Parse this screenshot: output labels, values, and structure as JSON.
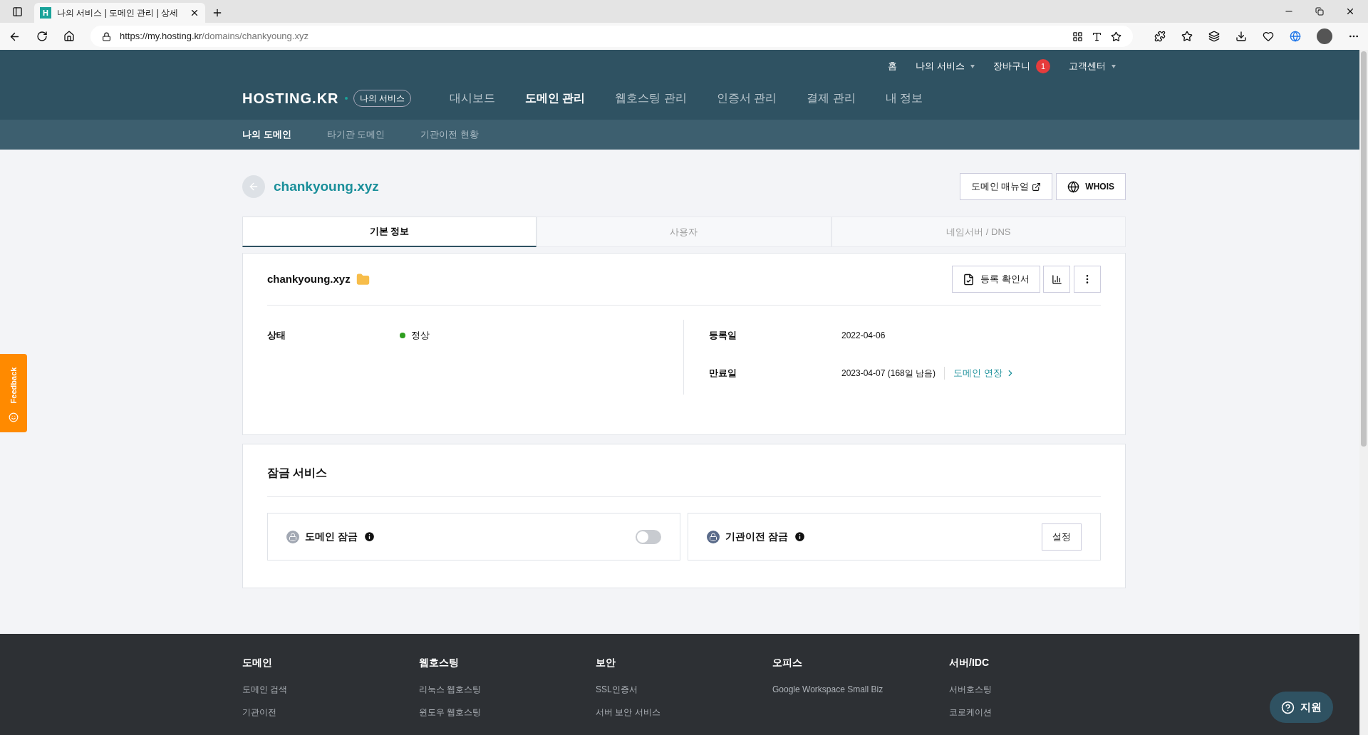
{
  "browser": {
    "favicon": "H",
    "tab_title": "나의 서비스 | 도메인 관리 | 상세",
    "url_host": "https://my.hosting.kr",
    "url_path": "/domains/chankyoung.xyz"
  },
  "top_links": [
    {
      "label": "홈",
      "dropdown": false
    },
    {
      "label": "나의 서비스",
      "dropdown": true
    },
    {
      "label": "장바구니",
      "dropdown": false,
      "badge": "1"
    },
    {
      "label": "고객센터",
      "dropdown": true
    }
  ],
  "logo": {
    "text": "HOSTING.KR",
    "badge": "나의 서비스"
  },
  "nav": [
    {
      "label": "대시보드",
      "selected": false
    },
    {
      "label": "도메인 관리",
      "selected": true
    },
    {
      "label": "웹호스팅 관리",
      "selected": false
    },
    {
      "label": "인증서 관리",
      "selected": false
    },
    {
      "label": "결제 관리",
      "selected": false
    },
    {
      "label": "내 정보",
      "selected": false
    }
  ],
  "subnav": [
    {
      "label": "나의 도메인",
      "selected": true
    },
    {
      "label": "타기관 도메인",
      "selected": false
    },
    {
      "label": "기관이전 현황",
      "selected": false
    }
  ],
  "page": {
    "title": "chankyoung.xyz",
    "manual_button": "도메인 매뉴얼",
    "whois_button": "WHOIS"
  },
  "tabs": [
    {
      "label": "기본 정보",
      "selected": true
    },
    {
      "label": "사용자",
      "selected": false
    },
    {
      "label": "네임서버 / DNS",
      "selected": false
    }
  ],
  "info": {
    "domain": "chankyoung.xyz",
    "certificate_button": "등록 확인서",
    "status": {
      "label": "상태",
      "value": "정상",
      "color": "#2e9e1f"
    },
    "registered": {
      "label": "등록일",
      "value": "2022-04-06"
    },
    "expires": {
      "label": "만료일",
      "value": "2023-04-07 (168일 남음)",
      "link": "도메인 연장"
    }
  },
  "lock": {
    "title": "잠금 서비스",
    "items": [
      {
        "kind": "toggle",
        "label": "도메인 잠금",
        "on": false
      },
      {
        "kind": "button",
        "label": "기관이전 잠금",
        "button": "설정"
      }
    ]
  },
  "footer": [
    {
      "heading": "도메인",
      "links": [
        "도메인 검색",
        "기관이전"
      ]
    },
    {
      "heading": "웹호스팅",
      "links": [
        "리눅스 웹호스팅",
        "윈도우 웹호스팅"
      ]
    },
    {
      "heading": "보안",
      "links": [
        "SSL인증서",
        "서버 보안 서비스"
      ]
    },
    {
      "heading": "오피스",
      "links": [
        "Google Workspace Small Biz"
      ]
    },
    {
      "heading": "서버/IDC",
      "links": [
        "서버호스팅",
        "코로케이션"
      ]
    }
  ],
  "feedback": "Feedback",
  "support": "지원"
}
